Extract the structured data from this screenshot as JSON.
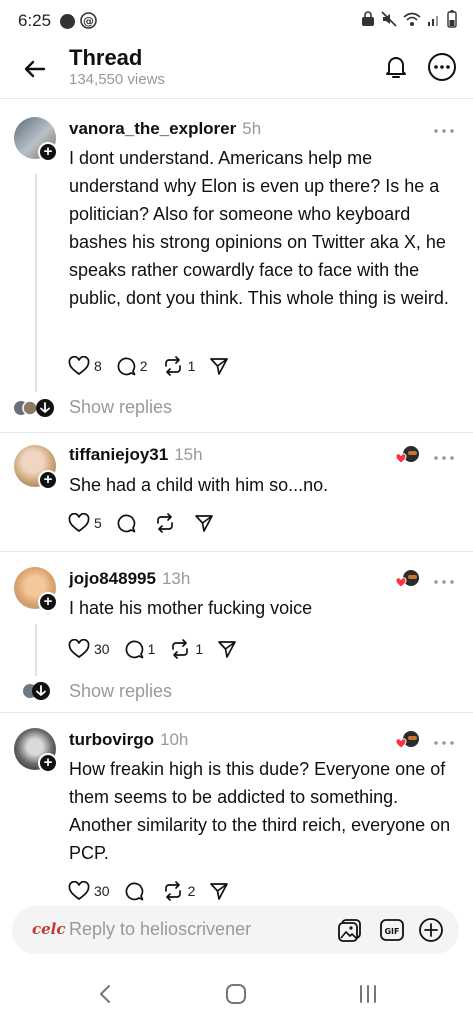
{
  "status_bar": {
    "time": "6:25",
    "icons_left": [
      "notification-dot-icon",
      "threads-icon"
    ],
    "icons_right": [
      "lock-icon",
      "mute-icon",
      "wifi-icon",
      "signal-icon",
      "battery-icon"
    ]
  },
  "header": {
    "title": "Thread",
    "views": "134,550 views"
  },
  "posts": [
    {
      "username": "vanora_the_explorer",
      "time": "5h",
      "text": "I dont understand. Americans help me understand why Elon is even up there? Is he a politician? Also for someone who keyboard bashes his strong opinions on Twitter aka X, he speaks rather cowardly face to face with the public, dont you think. This whole thing is weird.",
      "likes": "8",
      "comments": "2",
      "reposts": "1",
      "show_replies": "Show replies"
    },
    {
      "username": "tiffaniejoy31",
      "time": "15h",
      "text": "She had a child with him so...no.",
      "likes": "5",
      "comments": "",
      "reposts": ""
    },
    {
      "username": "jojo848995",
      "time": "13h",
      "text": "I hate his mother fucking voice",
      "likes": "30",
      "comments": "1",
      "reposts": "1",
      "show_replies": "Show replies"
    },
    {
      "username": "turbovirgo",
      "time": "10h",
      "text": "How freakin high is this dude? Everyone one of them seems to be addicted to something. Another similarity to the third reich, everyone on PCP.",
      "likes": "30",
      "comments": "",
      "reposts": "2"
    }
  ],
  "reply_bar": {
    "logo_text": "celc",
    "placeholder": "Reply to helioscrivener"
  },
  "colors": {
    "text": "#101010",
    "muted": "#999999",
    "divider": "#e6e6e6",
    "heart_red": "#ff3040"
  }
}
